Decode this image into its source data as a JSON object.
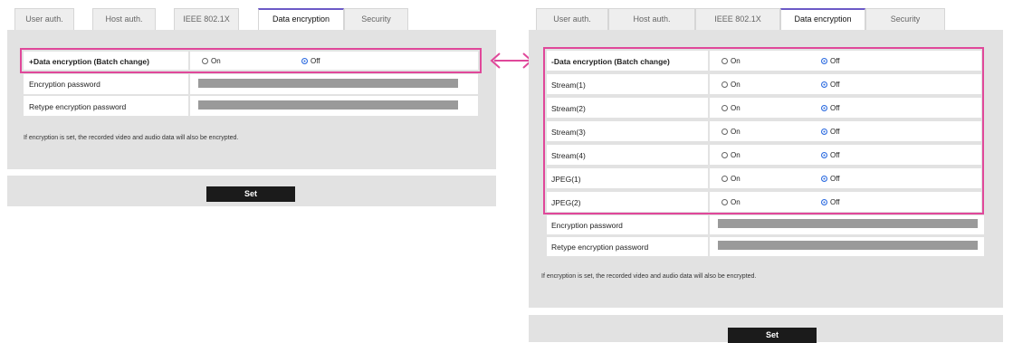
{
  "tabs": [
    "User auth.",
    "Host auth.",
    "IEEE 802.1X",
    "Data encryption",
    "Security"
  ],
  "active_tab": "Data encryption",
  "left": {
    "batch_label": "+Data encryption (Batch change)",
    "on_label": "On",
    "off_label": "Off",
    "enc_password_label": "Encryption password",
    "retype_label": "Retype encryption password",
    "note": "If encryption is set, the recorded video and audio data will also be encrypted.",
    "set_label": "Set"
  },
  "right": {
    "rows": [
      {
        "label": "-Data encryption (Batch change)",
        "on": "On",
        "off": "Off",
        "selected": "off"
      },
      {
        "label": "Stream(1)",
        "on": "On",
        "off": "Off",
        "selected": "off"
      },
      {
        "label": "Stream(2)",
        "on": "On",
        "off": "Off",
        "selected": "off"
      },
      {
        "label": "Stream(3)",
        "on": "On",
        "off": "Off",
        "selected": "off"
      },
      {
        "label": "Stream(4)",
        "on": "On",
        "off": "Off",
        "selected": "off"
      },
      {
        "label": "JPEG(1)",
        "on": "On",
        "off": "Off",
        "selected": "off"
      },
      {
        "label": "JPEG(2)",
        "on": "On",
        "off": "Off",
        "selected": "off"
      }
    ],
    "enc_password_label": "Encryption password",
    "retype_label": "Retype encryption password",
    "note": "If encryption is set, the recorded video and audio data will also be encrypted.",
    "set_label": "Set"
  },
  "colors": {
    "highlight": "#e0489a",
    "active_tab_accent": "#6c5ac7",
    "radio_selected": "#2c6be0"
  }
}
